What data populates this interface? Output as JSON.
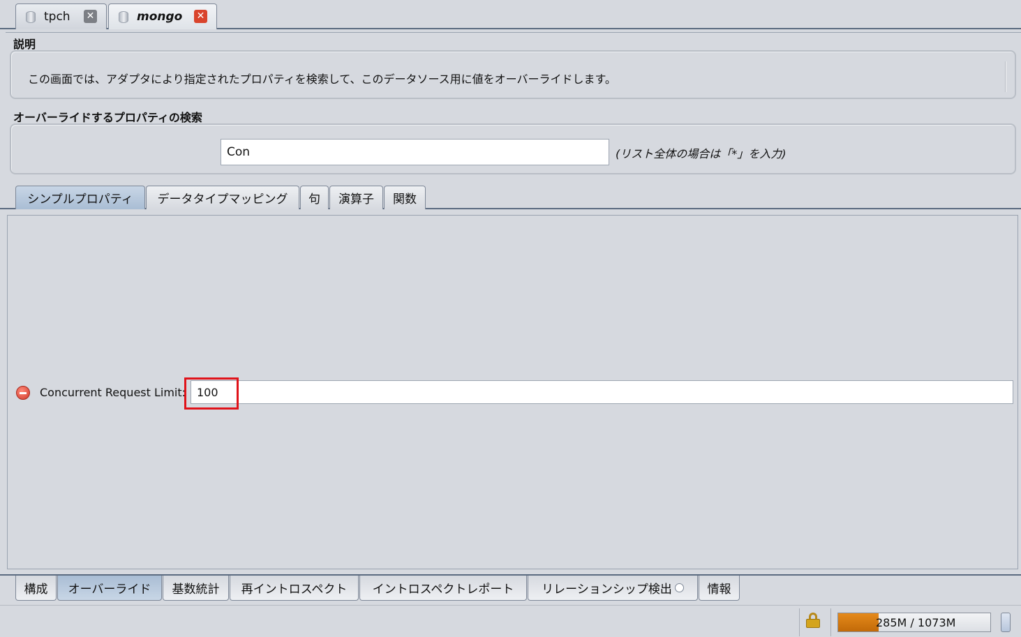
{
  "doc_tabs": [
    {
      "label": "tpch"
    },
    {
      "label": "mongo"
    }
  ],
  "description": {
    "title": "説明",
    "text": "この画面では、アダプタにより指定されたプロパティを検索して、このデータソース用に値をオーバーライドします。"
  },
  "search": {
    "title": "オーバーライドするプロパティの検索",
    "value": "Con",
    "hint": "(リスト全体の場合は「*」を入力)"
  },
  "property_tabs": [
    "シンプルプロパティ",
    "データタイプマッピング",
    "句",
    "演算子",
    "関数"
  ],
  "property": {
    "label": "Concurrent Request Limit:",
    "value": "100"
  },
  "bottom_tabs": [
    "構成",
    "オーバーライド",
    "基数統計",
    "再イントロスペクト",
    "イントロスペクトレポート",
    "リレーションシップ検出",
    "情報"
  ],
  "status": {
    "memory_text": "285M / 1073M",
    "memory_used_fraction": 0.266
  },
  "colors": {
    "highlight": "#e0131a",
    "memory_fill": "#e58a1b",
    "active_tab": "#b9cbe0"
  }
}
